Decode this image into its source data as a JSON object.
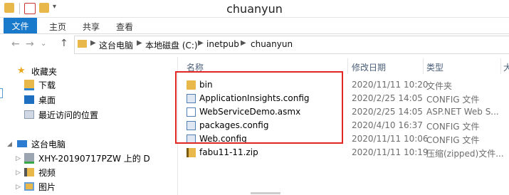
{
  "window": {
    "title": "chuanyun"
  },
  "ribbon": {
    "tabs": [
      "文件",
      "主页",
      "共享",
      "查看"
    ]
  },
  "address": {
    "crumbs": [
      "这台电脑",
      "本地磁盘 (C:)",
      "inetpub",
      "chuanyun"
    ]
  },
  "nav": {
    "favorites": "收藏夹",
    "items": [
      "下载",
      "桌面",
      "最近访问的位置"
    ],
    "computer": "这台电脑",
    "computer_items": [
      "XHY-20190717PZW 上的 D",
      "视频",
      "图片"
    ]
  },
  "columns": {
    "name": "名称",
    "date": "修改日期",
    "type": "类型",
    "size": "大"
  },
  "files": [
    {
      "name": "bin",
      "date": "2020/11/11 10:20",
      "type": "文件夹",
      "icon": "folder-icon"
    },
    {
      "name": "ApplicationInsights.config",
      "date": "2020/2/25 14:05",
      "type": "CONFIG 文件",
      "icon": "config-file-icon"
    },
    {
      "name": "WebServiceDemo.asmx",
      "date": "2020/2/25 14:05",
      "type": "ASP.NET Web S...",
      "icon": "asmx-file-icon"
    },
    {
      "name": "packages.config",
      "date": "2020/4/10 16:37",
      "type": "CONFIG 文件",
      "icon": "config-file-icon"
    },
    {
      "name": "Web.config",
      "date": "2020/11/11 10:06",
      "type": "CONFIG 文件",
      "icon": "config-file-icon"
    },
    {
      "name": "fabu11-11.zip",
      "date": "2020/11/11 10:19",
      "type": "压缩(zipped)文件...",
      "icon": "zip-folder-icon"
    }
  ],
  "colors": {
    "accent": "#1979ca",
    "highlight": "#e22626",
    "folder": "#e8b84a"
  }
}
